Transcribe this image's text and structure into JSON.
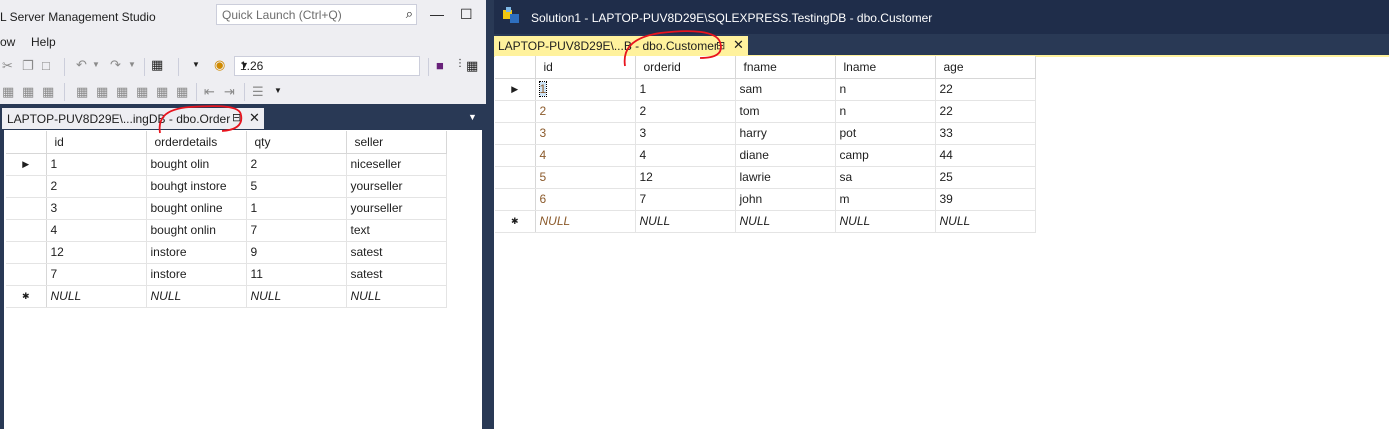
{
  "left_window": {
    "app_title_partial": "L Server Management Studio",
    "quick_launch_placeholder": "Quick Launch (Ctrl+Q)",
    "minimize_glyph": "—",
    "maximize_glyph": "☐",
    "menu": [
      "ow",
      "Help"
    ],
    "zoom_value": "1.26",
    "tab": {
      "label_prefix": "LAPTOP-PUV8D29E\\...ingDB - ",
      "label_table": "dbo.Order",
      "pin_glyph": "⊟",
      "close_glyph": "✕"
    },
    "grid": {
      "columns": [
        "id",
        "orderdetails",
        "qty",
        "seller"
      ],
      "rows": [
        [
          "1",
          "bought olin",
          "2",
          "niceseller"
        ],
        [
          "2",
          "bouhgt instore",
          "5",
          "yourseller"
        ],
        [
          "3",
          "bought online",
          "1",
          "yourseller"
        ],
        [
          "4",
          "bought onlin",
          "7",
          "text"
        ],
        [
          "12",
          "instore",
          "9",
          "satest"
        ],
        [
          "7",
          "instore",
          "11",
          "satest"
        ]
      ],
      "null_row": [
        "NULL",
        "NULL",
        "NULL",
        "NULL"
      ]
    }
  },
  "right_window": {
    "title": "Solution1 - LAPTOP-PUV8D29E\\SQLEXPRESS.TestingDB - dbo.Customer",
    "tab": {
      "label_prefix": "LAPTOP-PUV8D29E\\...B - ",
      "label_table": "dbo.Customer",
      "pin_glyph": "⊟",
      "close_glyph": "✕"
    },
    "grid": {
      "columns": [
        "id",
        "orderid",
        "fname",
        "lname",
        "age"
      ],
      "rows": [
        [
          "1",
          "1",
          "sam",
          "n",
          "22"
        ],
        [
          "2",
          "2",
          "tom",
          "n",
          "22"
        ],
        [
          "3",
          "3",
          "harry",
          "pot",
          "33"
        ],
        [
          "4",
          "4",
          "diane",
          "camp",
          "44"
        ],
        [
          "5",
          "12",
          "lawrie",
          "sa",
          "25"
        ],
        [
          "6",
          "7",
          "john",
          "m",
          "39"
        ]
      ],
      "null_row": [
        "NULL",
        "NULL",
        "NULL",
        "NULL",
        "NULL"
      ]
    }
  },
  "glyphs": {
    "current_row": "▶",
    "new_row": "✱",
    "search": "⌕",
    "dropdown": "▼"
  },
  "colors": {
    "titlebar_dark": "#1f2d4a",
    "doc_well": "#293955",
    "active_tab": "#fff29d",
    "annotation": "#e8141e"
  }
}
